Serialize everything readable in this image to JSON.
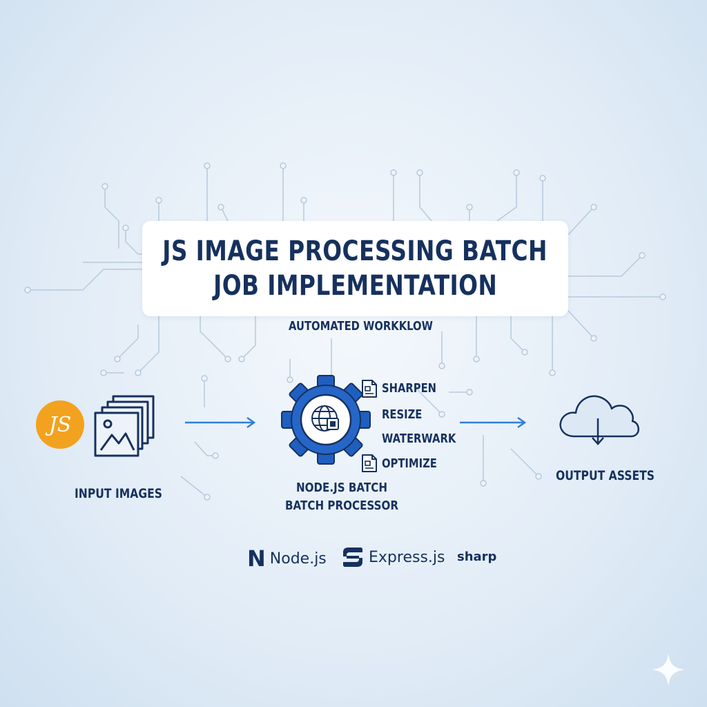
{
  "title": {
    "line1": "JS IMAGE PROCESSING BATCH",
    "line2": "JOB IMPLEMENTATION"
  },
  "subtitle": "AUTOMATED WORKKLOW",
  "input": {
    "badge": "JS",
    "label": "INPUT IMAGES"
  },
  "processor": {
    "label_line1": "NODE.JS BATCH",
    "label_line2": "BATCH PROCESSOR",
    "steps": [
      "SHARPEN",
      "RESIZE",
      "WATERWARK",
      "OPTIMIZE"
    ]
  },
  "output": {
    "label": "OUTPUT ASSETS"
  },
  "tech_stack": {
    "node": {
      "logo": "N",
      "label": "Node.js"
    },
    "express": {
      "label": "Express.js"
    },
    "sharp": {
      "label": "sharp"
    }
  },
  "colors": {
    "navy": "#16315e",
    "accent_blue": "#2f7fd6",
    "gear_blue": "#1f5fbf",
    "js_orange": "#f3a21f",
    "circuit": "#b6c9dc"
  },
  "icons": {
    "input": "image-stack-icon",
    "processor": "gear-icon",
    "output": "cloud-download-icon",
    "step_sharpen": "document-icon",
    "step_optimize": "document-icon",
    "corner": "sparkle-icon"
  }
}
